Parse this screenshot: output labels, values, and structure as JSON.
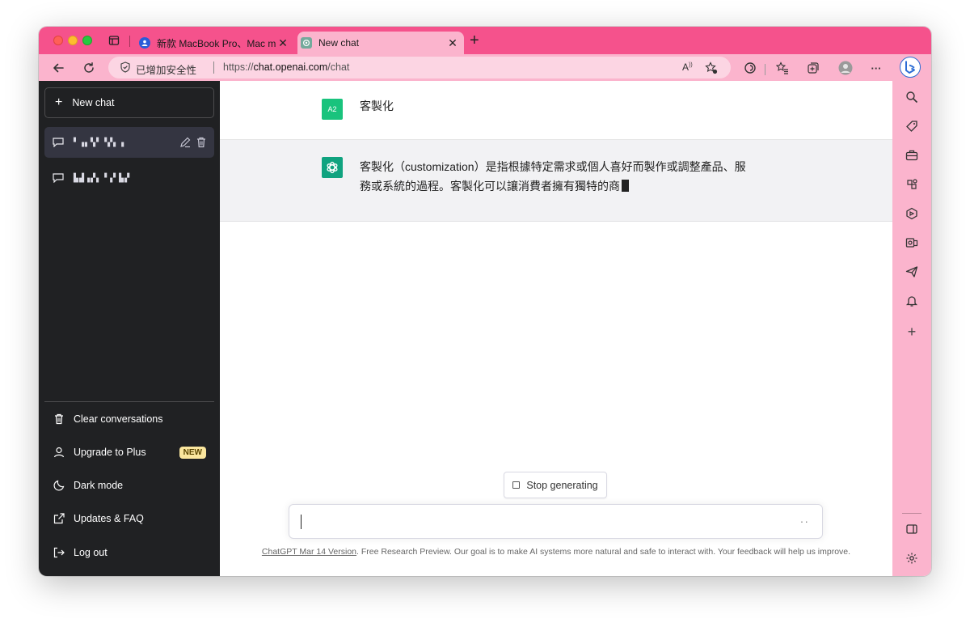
{
  "browser": {
    "tabs": [
      {
        "title": "新款 MacBook Pro、Mac mini 上",
        "active": false
      },
      {
        "title": "New chat",
        "active": true
      }
    ],
    "new_tab_symbol": "+",
    "security_label": "已增加安全性",
    "url_scheme": "https://",
    "url_host": "chat.openai.com",
    "url_path": "/chat",
    "more_symbol": "···"
  },
  "sidebar": {
    "new_chat_label": "New chat",
    "conversations": [
      {
        "title": "▘▗▖▚▘▝▞▖▗",
        "active": true
      },
      {
        "title": "▙▟▗▞▖▝▗▘▙▞",
        "active": false
      }
    ],
    "items": [
      {
        "label": "Clear conversations",
        "icon": "trash-icon"
      },
      {
        "label": "Upgrade to Plus",
        "icon": "user-icon",
        "badge": "NEW"
      },
      {
        "label": "Dark mode",
        "icon": "moon-icon"
      },
      {
        "label": "Updates & FAQ",
        "icon": "external-link-icon"
      },
      {
        "label": "Log out",
        "icon": "logout-icon"
      }
    ]
  },
  "chat": {
    "user_avatar": "A2",
    "user_message": "客製化",
    "bot_message_line1": "客製化（customization）是指根據特定需求或個人喜好而製作或調整產品、服",
    "bot_message_line2": "務或系統的過程。客製化可以讓消費者擁有獨特的商",
    "stop_label": "Stop generating",
    "input_dots": "··",
    "footer_link": "ChatGPT Mar 14 Version",
    "footer_text": ". Free Research Preview. Our goal is to make AI systems more natural and safe to interact with. Your feedback will help us improve."
  },
  "colors": {
    "tabstrip": "#f5528c",
    "toolbar": "#fbb4cd",
    "sidebar": "#202123",
    "accent_green": "#10a37f"
  }
}
